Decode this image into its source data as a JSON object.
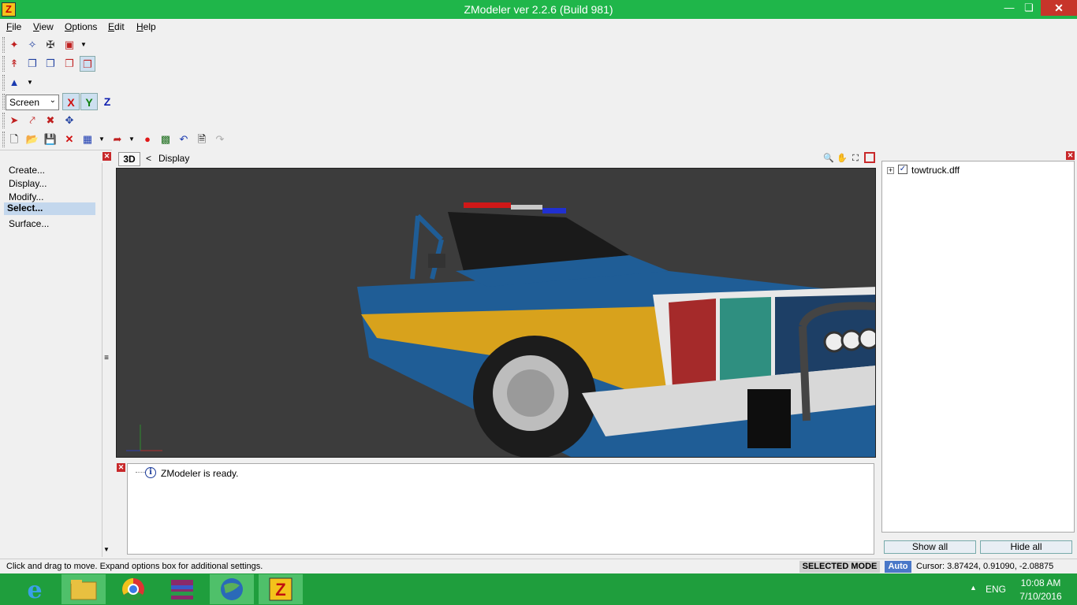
{
  "window": {
    "title": "ZModeler ver 2.2.6 (Build 981)",
    "app_icon": "Z"
  },
  "menu": [
    "File",
    "View",
    "Options",
    "Edit",
    "Help"
  ],
  "toolbar": {
    "coord_space": "Screen",
    "axes": [
      "X",
      "Y",
      "Z"
    ],
    "axis_colors": {
      "x": "#d01010",
      "y": "#108010",
      "z": "#1020b0"
    }
  },
  "left_panel": {
    "items": [
      "Create...",
      "Display...",
      "Modify...",
      "Select...",
      "Surface..."
    ],
    "selected_index": 3
  },
  "viewport": {
    "mode": "3D",
    "back": "<",
    "label": "Display"
  },
  "log": {
    "message": "ZModeler is ready."
  },
  "scene_tree": {
    "root": "towtruck.dff",
    "checked": true
  },
  "buttons": {
    "show_all": "Show all",
    "hide_all": "Hide all"
  },
  "status": {
    "hint": "Click and drag to move. Expand options box for additional settings.",
    "mode": "SELECTED MODE",
    "auto": "Auto",
    "cursor": "Cursor: 3.87424, 0.91090, -2.08875"
  },
  "taskbar": {
    "apps": [
      "internet-explorer-icon",
      "file-explorer-icon",
      "chrome-icon",
      "winrar-icon",
      "globe-app-icon",
      "zmodeler-icon"
    ],
    "language": "ENG",
    "time": "10:08 AM",
    "date": "7/10/2016"
  }
}
